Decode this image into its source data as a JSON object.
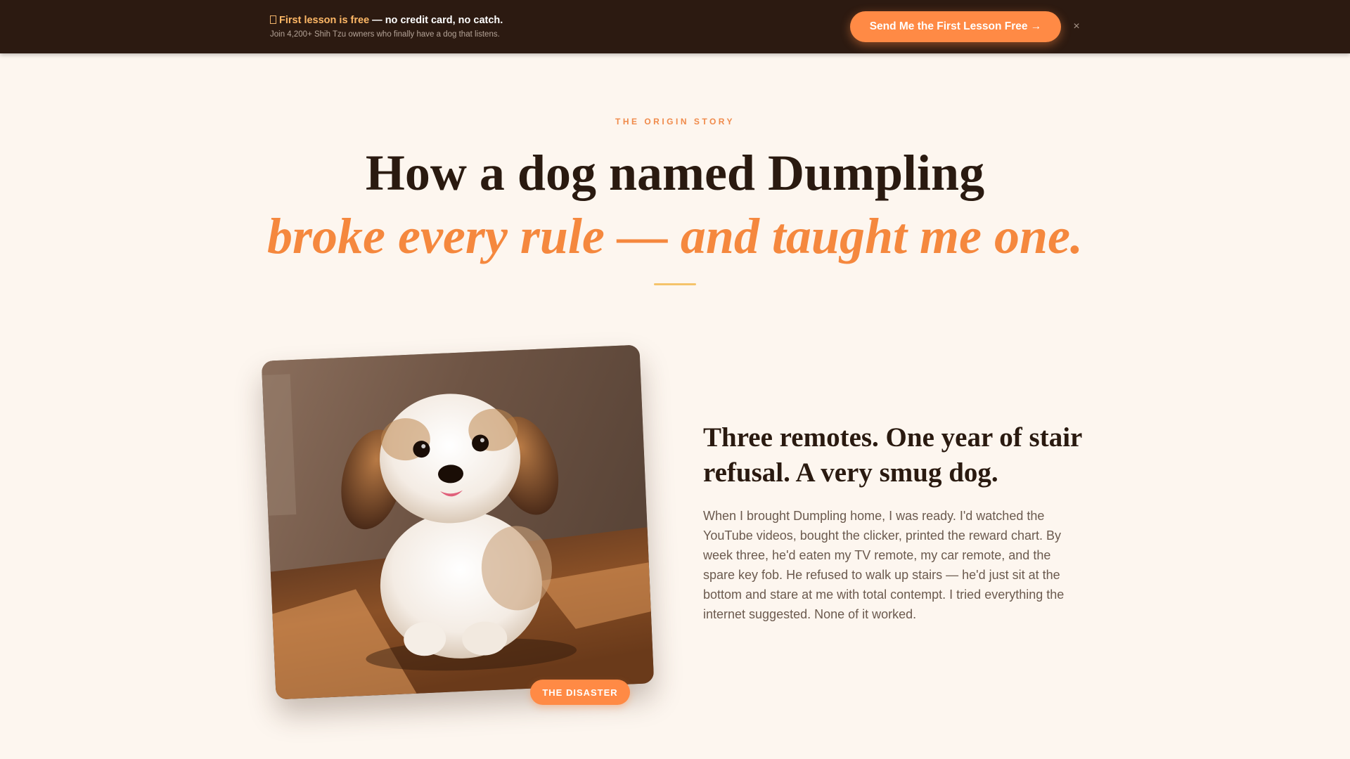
{
  "banner": {
    "icon": "gift-icon",
    "highlight": "First lesson is free",
    "headline_rest": " — no credit card, no catch.",
    "subtext": "Join 4,200+ Shih Tzu owners who finally have a dog that listens.",
    "cta_label": "Send Me the First Lesson Free →",
    "close_label": "×"
  },
  "hero": {
    "eyebrow": "THE ORIGIN STORY",
    "headline_line1": "How a dog named Dumpling",
    "headline_line2": "broke every rule — and taught me one."
  },
  "story": {
    "photo_alt": "Shih Tzu puppy sitting on a wooden floor",
    "badge": "THE DISASTER",
    "title": "Three remotes. One year of stair refusal. A very smug dog.",
    "body": "When I brought Dumpling home, I was ready. I'd watched the YouTube videos, bought the clicker, printed the reward chart. By week three, he'd eaten my TV remote, my car remote, and the spare key fob. He refused to walk up stairs — he'd just sit at the bottom and stare at me with total contempt. I tried everything the internet suggested. None of it worked."
  },
  "colors": {
    "banner_bg": "#2c1a11",
    "accent": "#ff8a45",
    "page_bg": "#fdf6ef",
    "headline_accent": "#f5883e"
  }
}
